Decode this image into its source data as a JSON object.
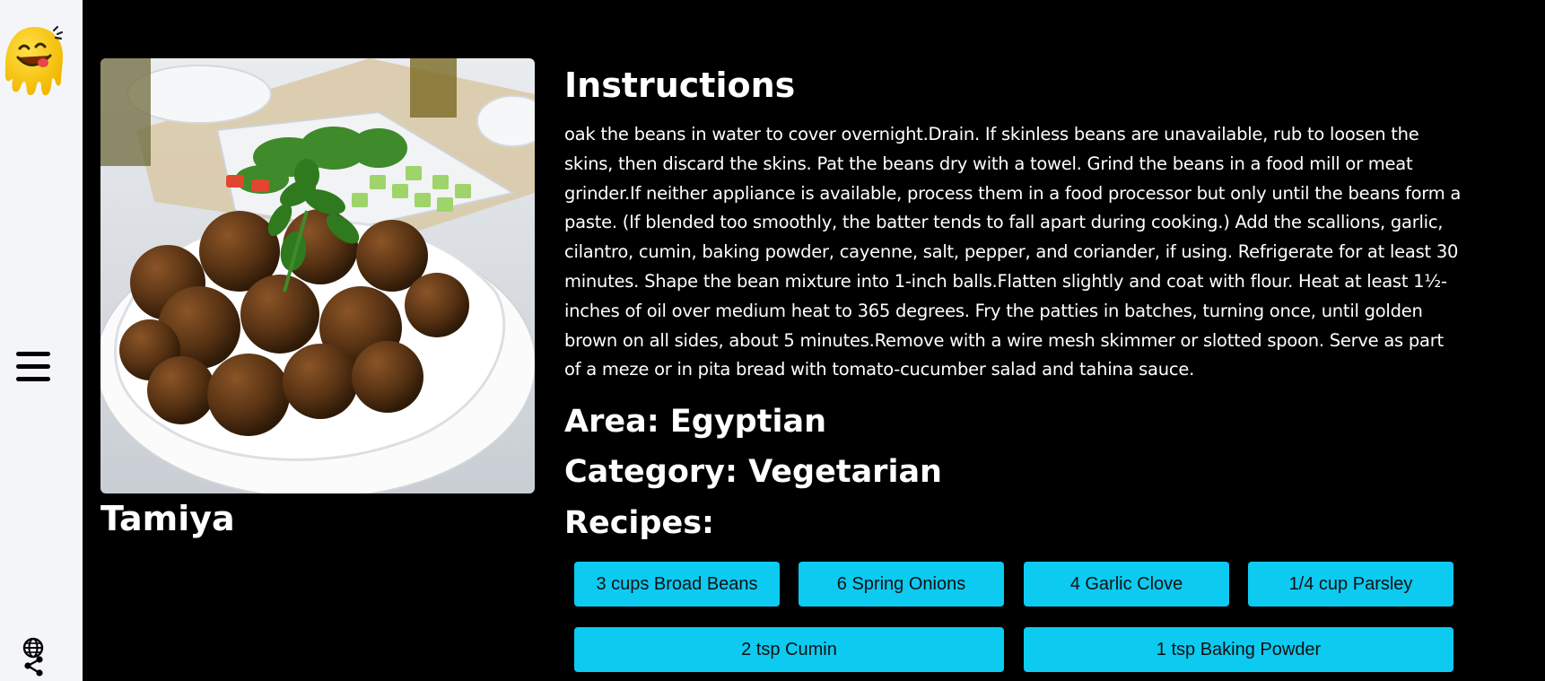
{
  "meal": {
    "name": "Tamiya",
    "image_alt": "Plate of falafel with salad"
  },
  "instructions": {
    "heading": "Instructions",
    "text": "oak the beans in water to cover overnight.Drain. If skinless beans are unavailable, rub to loosen the skins, then discard the skins. Pat the beans dry with a towel. Grind the beans in a food mill or meat grinder.If neither appliance is available, process them in a food processor but only until the beans form a paste. (If blended too smoothly, the batter tends to fall apart during cooking.) Add the scallions, garlic, cilantro, cumin, baking powder, cayenne, salt, pepper, and coriander, if using. Refrigerate for at least 30 minutes. Shape the bean mixture into 1-inch balls.Flatten slightly and coat with flour. Heat at least 1½-inches of oil over medium heat to 365 degrees. Fry the patties in batches, turning once, until golden brown on all sides, about 5 minutes.Remove with a wire mesh skimmer or slotted spoon. Serve as part of a meze or in pita bread with tomato-cucumber salad and tahina sauce."
  },
  "meta": {
    "area": "Area: Egyptian",
    "category": "Category: Vegetarian",
    "recipes_heading": "Recipes:"
  },
  "ingredients": [
    "3 cups Broad Beans",
    "6 Spring Onions",
    "4 Garlic Clove",
    "1/4 cup Parsley",
    "2 tsp Cumin",
    "1 tsp Baking Powder"
  ],
  "colors": {
    "background": "#000000",
    "sidebar": "#f4f5f8",
    "chip": "#0dcaf0",
    "logo": "#f2c400"
  },
  "icons": {
    "logo": "drooling-face-logo",
    "menu": "hamburger-menu-icon",
    "share": "globe-share-icon"
  }
}
